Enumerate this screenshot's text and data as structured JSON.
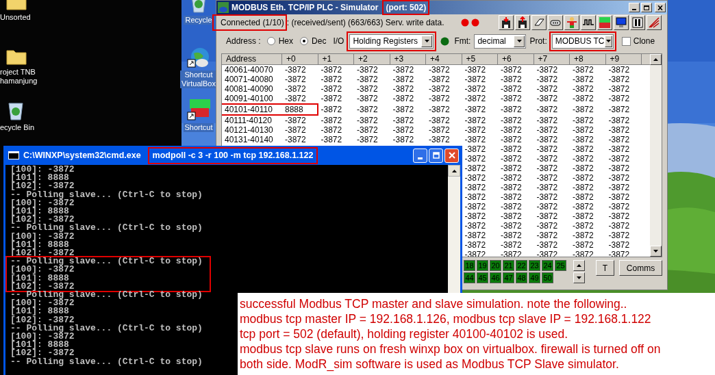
{
  "desktop_icons": [
    {
      "kind": "folder",
      "lines": [
        "Unsorted"
      ]
    },
    {
      "kind": "folder",
      "lines": [
        "roject TNB",
        "hamanjung"
      ]
    },
    {
      "kind": "recycle",
      "lines": [
        "ecycle Bin"
      ]
    },
    {
      "kind": "recycle",
      "lines": [
        "Recycle"
      ]
    },
    {
      "kind": "globe",
      "lines": [
        "Shortcut",
        "VirtualBox"
      ]
    },
    {
      "kind": "app",
      "lines": [
        "Shortcut"
      ]
    }
  ],
  "simulator_window": {
    "title": "MODBUS Eth. TCP/IP PLC - Simulator",
    "title_port": "(port: 502)",
    "connection": "Connected (1/10)",
    "status": ": (received/sent) (663/663) Serv. write data.",
    "toolbar": [
      {
        "kind": "load"
      },
      {
        "kind": "save"
      },
      {
        "kind": "eraser"
      },
      {
        "kind": "port"
      },
      {
        "kind": "person"
      },
      {
        "kind": "wave"
      },
      {
        "kind": "logo"
      },
      {
        "kind": "monitor"
      },
      {
        "kind": "columns"
      },
      {
        "kind": "ramp"
      }
    ],
    "address_label": "Address :",
    "radios": [
      {
        "label": "Hex",
        "selected": false
      },
      {
        "label": "Dec",
        "selected": true
      }
    ],
    "io_label": "I/O",
    "io_type": "Holding Registers",
    "fmt_label": "Fmt:",
    "fmt": "decimal",
    "prot_label": "Prot:",
    "prot": "MODBUS TC",
    "clone": {
      "label": "Clone",
      "checked": false
    },
    "table": {
      "columns": [
        "Address",
        "+0",
        "+1",
        "+2",
        "+3",
        "+4",
        "+5",
        "+6",
        "+7",
        "+8",
        "+9"
      ],
      "rows": [
        {
          "cells": [
            "40061-40070",
            "-3872",
            "-3872",
            "-3872",
            "-3872",
            "-3872",
            "-3872",
            "-3872",
            "-3872",
            "-3872",
            "-3872"
          ]
        },
        {
          "cells": [
            "40071-40080",
            "-3872",
            "-3872",
            "-3872",
            "-3872",
            "-3872",
            "-3872",
            "-3872",
            "-3872",
            "-3872",
            "-3872"
          ]
        },
        {
          "cells": [
            "40081-40090",
            "-3872",
            "-3872",
            "-3872",
            "-3872",
            "-3872",
            "-3872",
            "-3872",
            "-3872",
            "-3872",
            "-3872"
          ]
        },
        {
          "cells": [
            "40091-40100",
            "-3872",
            "-3872",
            "-3872",
            "-3872",
            "-3872",
            "-3872",
            "-3872",
            "-3872",
            "-3872",
            "-3872"
          ]
        },
        {
          "cells": [
            "40101-40110",
            "8888",
            "-3872",
            "-3872",
            "-3872",
            "-3872",
            "-3872",
            "-3872",
            "-3872",
            "-3872",
            "-3872"
          ],
          "framed": true
        },
        {
          "cells": [
            "40111-40120",
            "-3872",
            "-3872",
            "-3872",
            "-3872",
            "-3872",
            "-3872",
            "-3872",
            "-3872",
            "-3872",
            "-3872"
          ]
        },
        {
          "cells": [
            "40121-40130",
            "-3872",
            "-3872",
            "-3872",
            "-3872",
            "-3872",
            "-3872",
            "-3872",
            "-3872",
            "-3872",
            "-3872"
          ]
        },
        {
          "cells": [
            "40131-40140",
            "-3872",
            "-3872",
            "-3872",
            "-3872",
            "-3872",
            "-3872",
            "-3872",
            "-3872",
            "-3872",
            "-3872"
          ]
        },
        {
          "cells": [
            null,
            null,
            null,
            null,
            null,
            null,
            "-3872",
            "-3872",
            "-3872",
            "-3872",
            "-3872"
          ]
        },
        {
          "cells": [
            null,
            null,
            null,
            null,
            null,
            null,
            "-3872",
            "-3872",
            "-3872",
            "-3872",
            "-3872"
          ]
        },
        {
          "cells": [
            null,
            null,
            null,
            null,
            null,
            null,
            "-3872",
            "-3872",
            "-3872",
            "-3872",
            "-3872"
          ]
        },
        {
          "cells": [
            null,
            null,
            null,
            null,
            null,
            null,
            "-3872",
            "-3872",
            "-3872",
            "-3872",
            "-3872"
          ]
        },
        {
          "cells": [
            null,
            null,
            null,
            null,
            null,
            null,
            "-3872",
            "-3872",
            "-3872",
            "-3872",
            "-3872"
          ]
        },
        {
          "cells": [
            null,
            null,
            null,
            null,
            null,
            null,
            "-3872",
            "-3872",
            "-3872",
            "-3872",
            "-3872"
          ]
        },
        {
          "cells": [
            null,
            null,
            null,
            null,
            null,
            null,
            "-3872",
            "-3872",
            "-3872",
            "-3872",
            "-3872"
          ]
        },
        {
          "cells": [
            null,
            null,
            null,
            null,
            null,
            null,
            "-3872",
            "-3872",
            "-3872",
            "-3872",
            "-3872"
          ]
        },
        {
          "cells": [
            null,
            null,
            null,
            null,
            null,
            null,
            "-3872",
            "-3872",
            "-3872",
            "-3872",
            "-3872"
          ]
        },
        {
          "cells": [
            null,
            null,
            null,
            null,
            null,
            null,
            "-3872",
            "-3872",
            "-3872",
            "-3872",
            "-3872"
          ]
        },
        {
          "cells": [
            null,
            null,
            null,
            null,
            null,
            null,
            "-3872",
            "-3872",
            "-3872",
            "-3872",
            "-3872"
          ]
        },
        {
          "cells": [
            null,
            null,
            null,
            null,
            null,
            null,
            "-3872",
            "-3872",
            "-3872",
            "-3872",
            "-3872"
          ]
        }
      ]
    },
    "io_indicators": [
      [
        "18",
        "19",
        "20",
        "21",
        "22",
        "23",
        "24",
        "25"
      ],
      [
        "44",
        "45",
        "46",
        "47",
        "48",
        "49",
        "50"
      ]
    ],
    "buttons": [
      "T",
      "Comms"
    ]
  },
  "console_window": {
    "title": "C:\\WINXP\\system32\\cmd.exe",
    "command": "modpoll -c 3 -r 100 -m tcp 192.168.1.122",
    "lines": [
      {
        "text": "[100]: -3872"
      },
      {
        "text": "[101]: 8888"
      },
      {
        "text": "[102]: -3872"
      },
      {
        "text": "-- Polling slave... (Ctrl-C to stop)"
      },
      {
        "text": "[100]: -3872"
      },
      {
        "text": "[101]: 8888"
      },
      {
        "text": "[102]: -3872"
      },
      {
        "text": "-- Polling slave... (Ctrl-C to stop)"
      },
      {
        "text": "[100]: -3872"
      },
      {
        "text": "[101]: 8888"
      },
      {
        "text": "[102]: -3872"
      },
      {
        "text": "-- Polling slave... (Ctrl-C to stop)",
        "framed": true
      },
      {
        "text": "[100]: -3872",
        "framed": true
      },
      {
        "text": "[101]: 8888",
        "framed": true
      },
      {
        "text": "[102]: -3872",
        "framed": true
      },
      {
        "text": "-- Polling slave... (Ctrl-C to stop)"
      },
      {
        "text": "[100]: -3872"
      },
      {
        "text": "[101]: 8888"
      },
      {
        "text": "[102]: -3872"
      },
      {
        "text": "-- Polling slave... (Ctrl-C to stop)"
      },
      {
        "text": "[100]: -3872"
      },
      {
        "text": "[101]: 8888"
      },
      {
        "text": "[102]: -3872"
      },
      {
        "text": "-- Polling slave... (Ctrl-C to stop)"
      }
    ]
  },
  "note": {
    "lines": [
      "successful Modbus TCP master and slave simulation. note the following..",
      "modbus tcp master IP = 192.168.1.126, modbus tcp slave IP = 192.168.1.122",
      "tcp port = 502 (default), holding register 40100-40102 is used.",
      "modbus tcp slave runs on fresh winxp box on virtualbox. firewall is turned off on",
      "both side. ModR_sim software is used as Modbus TCP Slave simulator."
    ]
  }
}
